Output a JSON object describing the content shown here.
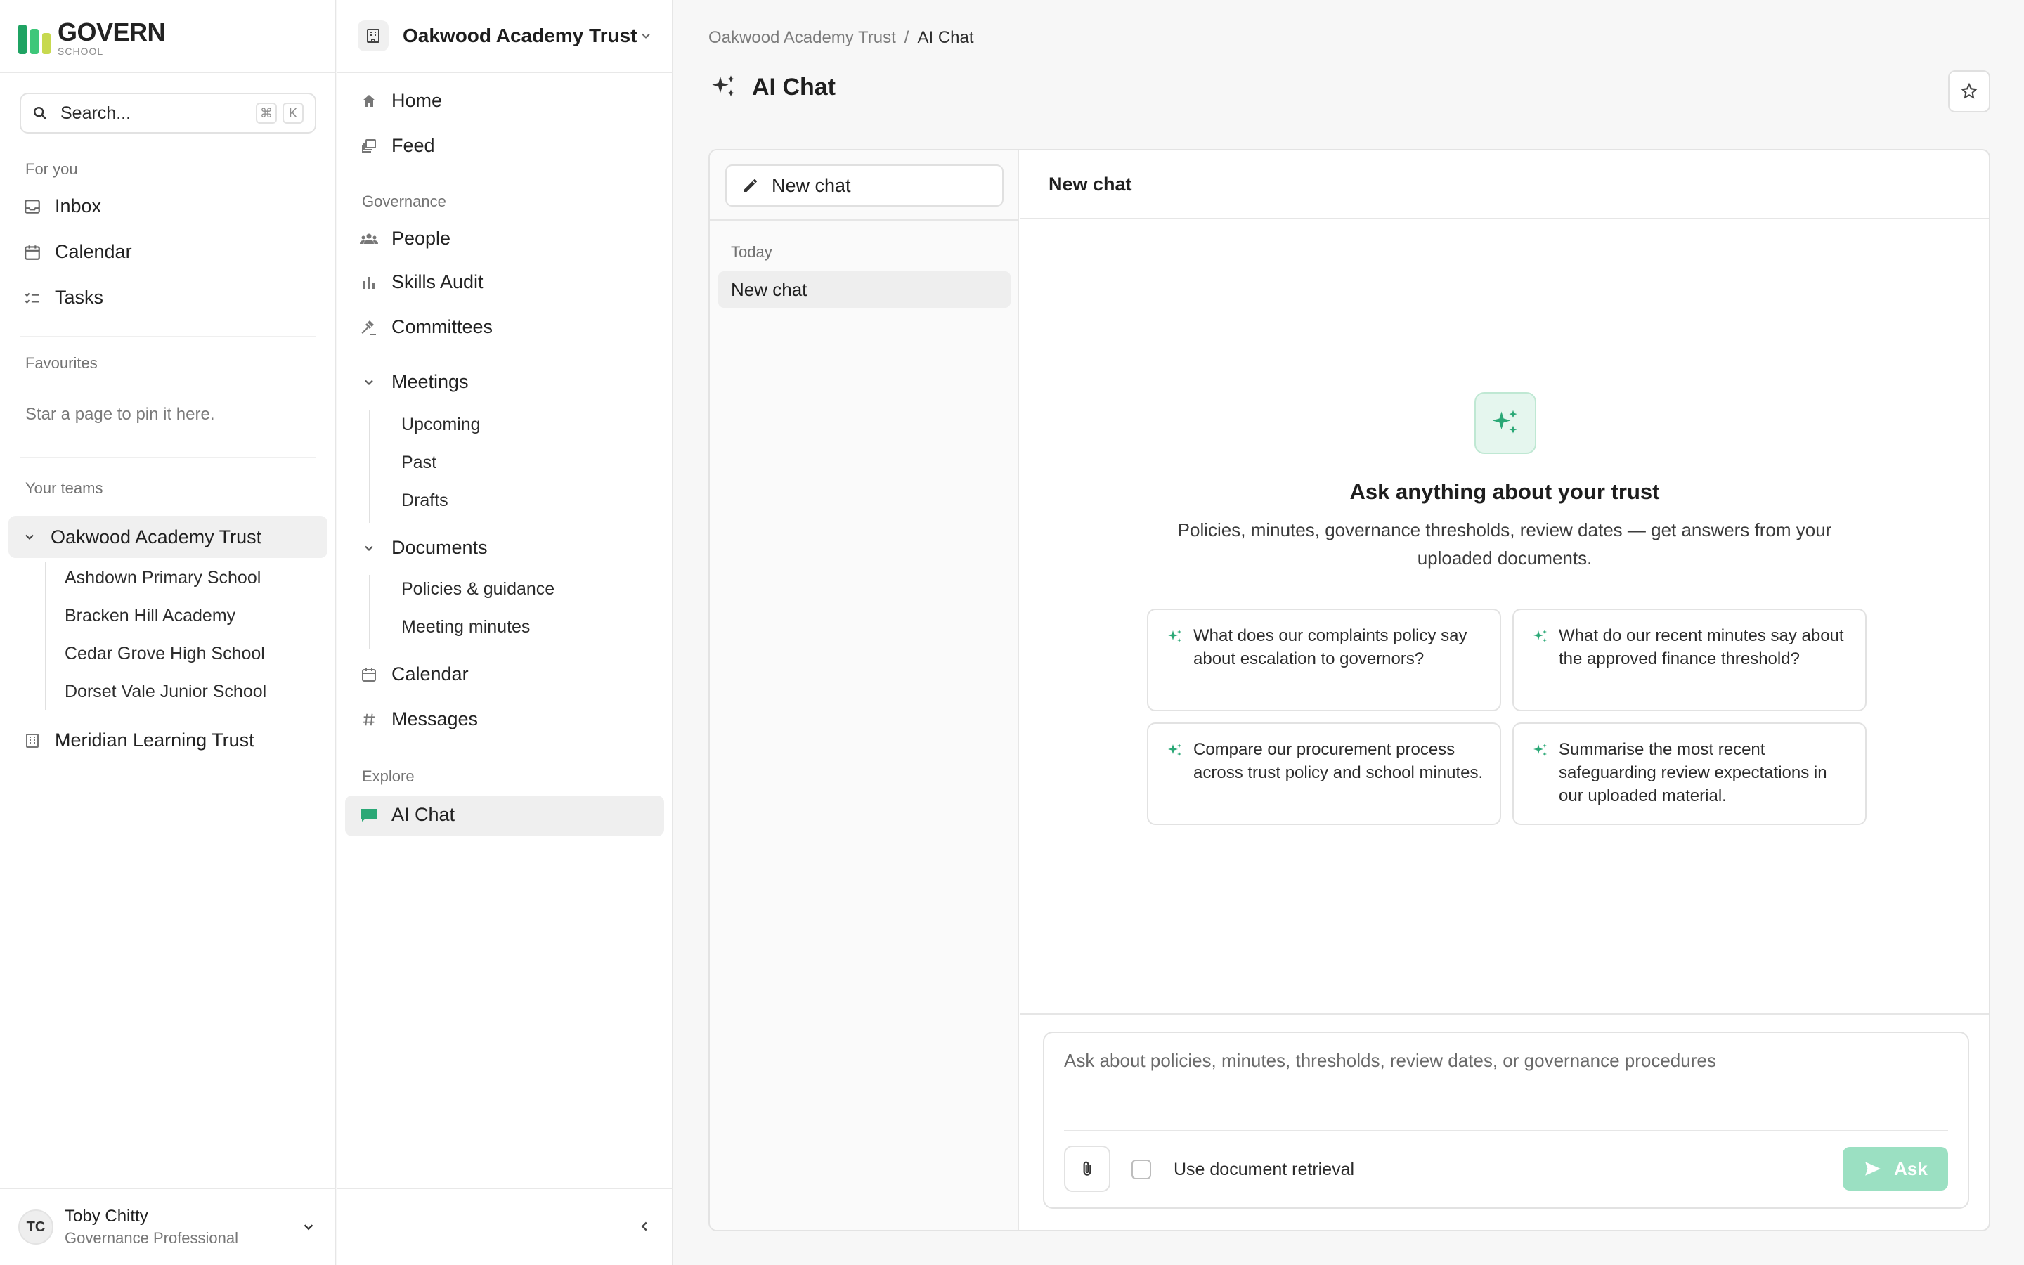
{
  "brand": {
    "name": "GOVERN",
    "sub": "SCHOOL",
    "bar_colors": [
      "#1fa363",
      "#3ec77a",
      "#8ad96b",
      "#f2c94c"
    ]
  },
  "search": {
    "placeholder": "Search...",
    "shortcut": [
      "⌘",
      "K"
    ]
  },
  "sidebar": {
    "for_you_label": "For you",
    "for_you": [
      {
        "label": "Inbox",
        "icon": "inbox-icon"
      },
      {
        "label": "Calendar",
        "icon": "calendar-icon"
      },
      {
        "label": "Tasks",
        "icon": "tasks-icon"
      }
    ],
    "favourites_label": "Favourites",
    "favourites_empty": "Star a page to pin it here.",
    "teams_label": "Your teams",
    "teams": [
      {
        "label": "Oakwood Academy Trust",
        "expanded": true,
        "schools": [
          "Ashdown Primary School",
          "Bracken Hill Academy",
          "Cedar Grove High School",
          "Dorset Vale Junior School"
        ]
      },
      {
        "label": "Meridian Learning Trust",
        "expanded": false
      }
    ]
  },
  "user": {
    "initials": "TC",
    "name": "Toby Chitty",
    "role": "Governance Professional"
  },
  "org_nav": {
    "org_name": "Oakwood Academy Trust",
    "top": [
      {
        "label": "Home"
      },
      {
        "label": "Feed"
      }
    ],
    "governance_label": "Governance",
    "governance": [
      {
        "label": "People"
      },
      {
        "label": "Skills Audit"
      },
      {
        "label": "Committees"
      }
    ],
    "meetings": {
      "label": "Meetings",
      "children": [
        "Upcoming",
        "Past",
        "Drafts"
      ]
    },
    "documents": {
      "label": "Documents",
      "children": [
        "Policies & guidance",
        "Meeting minutes"
      ]
    },
    "other": [
      {
        "label": "Calendar"
      },
      {
        "label": "Messages"
      }
    ],
    "explore_label": "Explore",
    "explore": [
      {
        "label": "AI Chat",
        "active": true
      }
    ]
  },
  "breadcrumb": {
    "parent": "Oakwood Academy Trust",
    "separator": "/",
    "current": "AI Chat"
  },
  "page": {
    "title": "AI Chat"
  },
  "chat": {
    "new_chat_button": "New chat",
    "list_group": "Today",
    "list_items": [
      "New chat"
    ],
    "header_title": "New chat",
    "hero_title": "Ask anything about your trust",
    "hero_subtitle": "Policies, minutes, governance thresholds, review dates — get answers from your uploaded documents.",
    "suggestions": [
      "What does our complaints policy say about escalation to governors?",
      "What do our recent minutes say about the approved finance threshold?",
      "Compare our procurement process across trust policy and school minutes.",
      "Summarise the most recent safeguarding review expectations in our uploaded material."
    ],
    "composer_placeholder": "Ask about policies, minutes, thresholds, review dates, or governance procedures",
    "retrieval_label": "Use document retrieval",
    "retrieval_checked": false,
    "ask_label": "Ask",
    "accent": "#2aa876"
  }
}
